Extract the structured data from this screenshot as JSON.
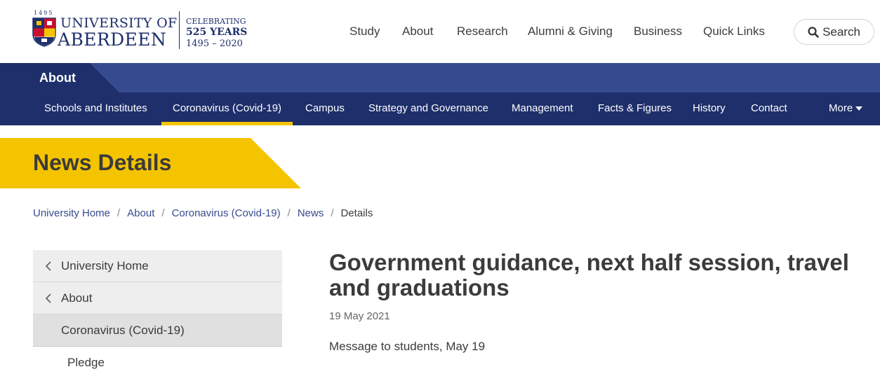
{
  "header": {
    "logo": {
      "founded": "1495",
      "line1": "UNIVERSITY OF",
      "line2": "ABERDEEN",
      "celebrating": "CELEBRATING",
      "years": "525 YEARS",
      "range": "1495 – 2020"
    },
    "nav": [
      "Study",
      "About",
      "Research",
      "Alumni & Giving",
      "Business",
      "Quick Links"
    ],
    "search_label": "Search"
  },
  "section": {
    "title": "About",
    "subnav": [
      "Schools and Institutes",
      "Coronavirus (Covid-19)",
      "Campus",
      "Strategy and Governance",
      "Management",
      "Facts & Figures",
      "History",
      "Contact"
    ],
    "active_item": "Coronavirus (Covid-19)",
    "more_label": "More"
  },
  "banner": {
    "title": "News Details"
  },
  "breadcrumb": [
    "University Home",
    "About",
    "Coronavirus (Covid-19)",
    "News",
    "Details"
  ],
  "leftnav": {
    "items": [
      "University Home",
      "About",
      "Coronavirus (Covid-19)"
    ],
    "sub_items": [
      "Pledge"
    ]
  },
  "article": {
    "title": "Government guidance, next half session, travel and graduations",
    "date": "19 May 2021",
    "summary": "Message to students, May 19"
  },
  "colors": {
    "brand_navy": "#1e2f6b",
    "section_blue": "#364b8f",
    "accent_yellow": "#f5c400"
  }
}
